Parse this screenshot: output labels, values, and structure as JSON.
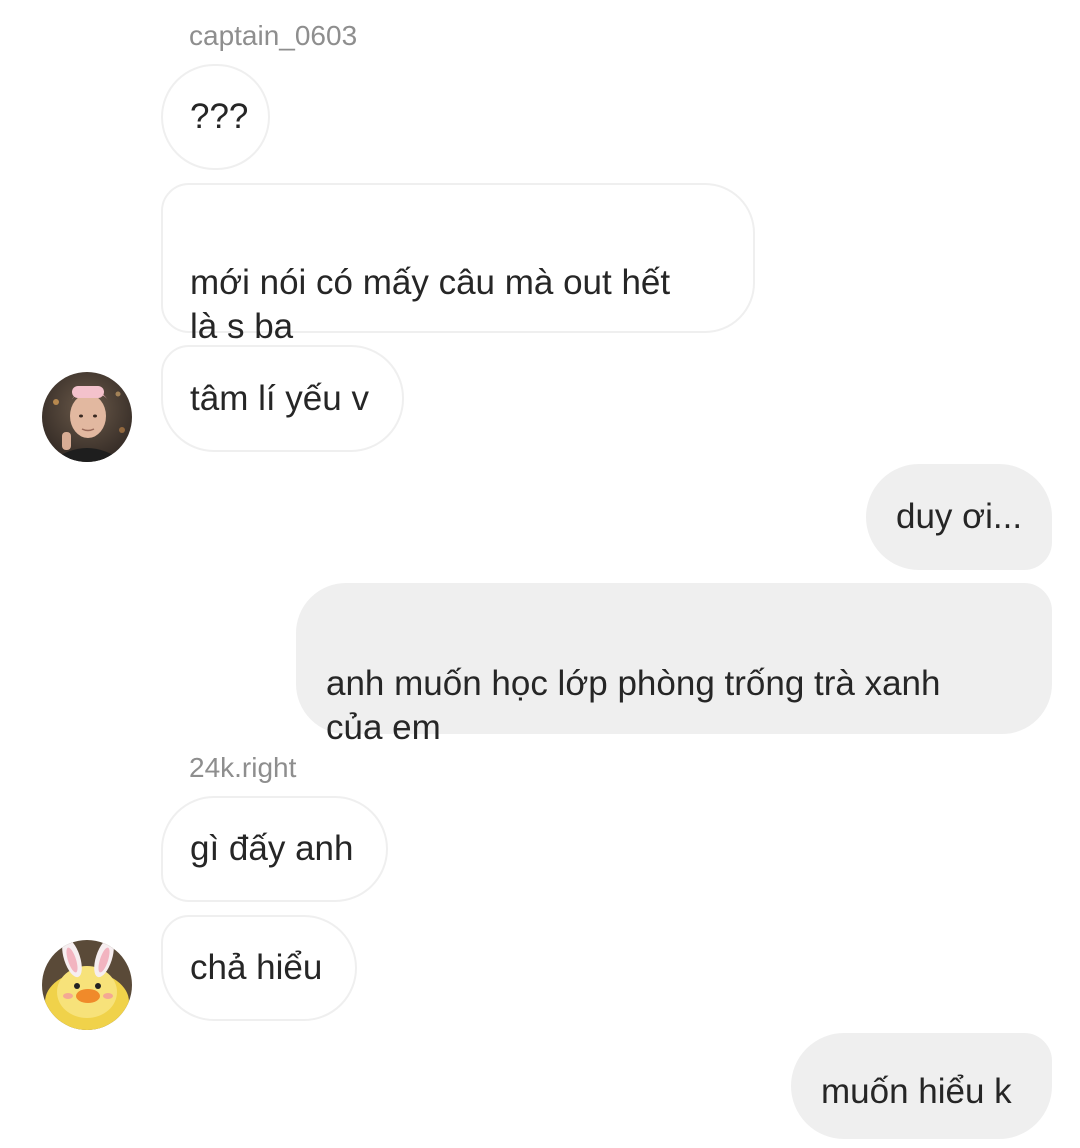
{
  "conversation": {
    "groups": [
      {
        "sender": "captain_0603",
        "avatar_icon": "user-avatar-icon",
        "messages": [
          "???",
          "mới nói có mấy câu mà out hết\nlà s ba",
          "tâm lí yếu v"
        ]
      },
      {
        "sender": "me",
        "messages": [
          "duy ơi...",
          "anh muốn học lớp phòng trống trà xanh\ncủa em"
        ]
      },
      {
        "sender": "24k.right",
        "avatar_icon": "duck-plush-avatar-icon",
        "messages": [
          "gì đấy anh",
          "chả hiểu"
        ]
      },
      {
        "sender": "me",
        "messages": [
          "muốn hiểu k"
        ]
      }
    ]
  },
  "colors": {
    "incoming_bubble_bg": "#ffffff",
    "incoming_bubble_border": "#efefef",
    "outgoing_bubble_bg": "#efefef",
    "username_text": "#8e8e8e",
    "message_text": "#262626"
  }
}
